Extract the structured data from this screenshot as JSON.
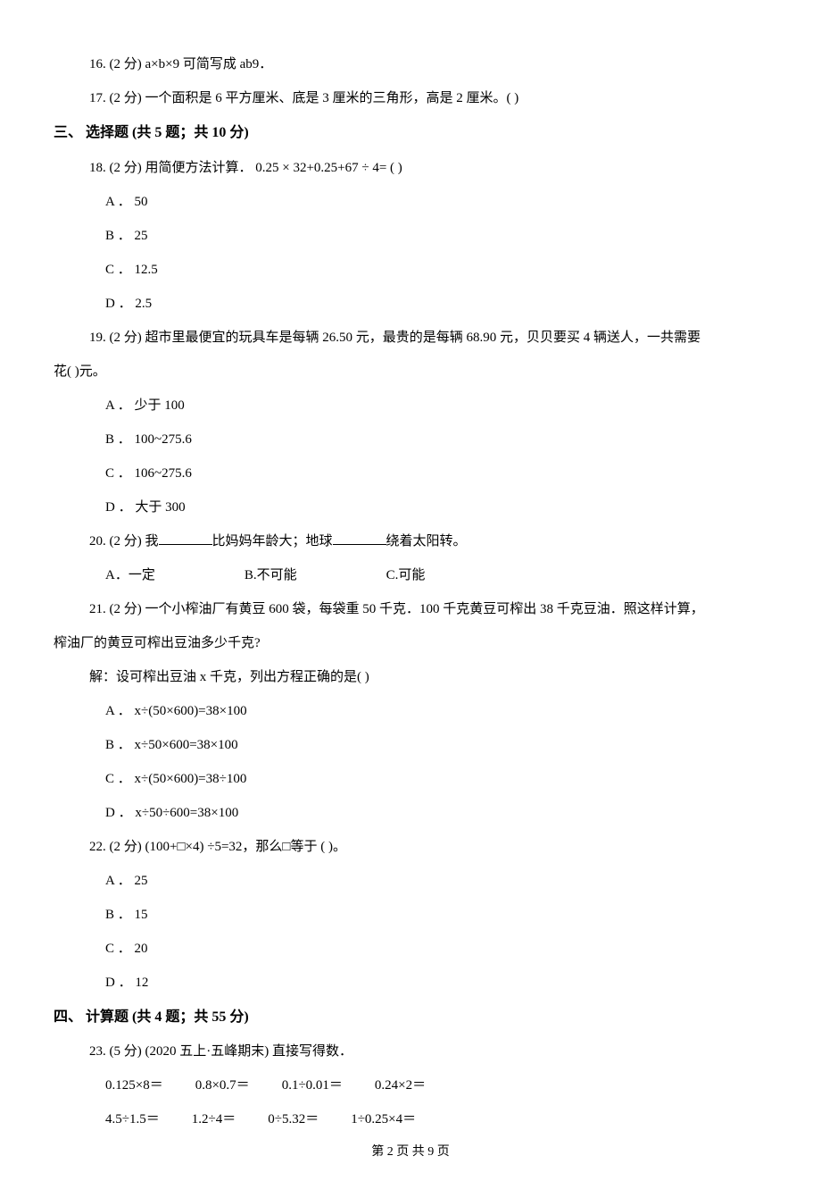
{
  "q16": "16.  (2 分)   a×b×9 可简写成 ab9．",
  "q17": "17.  (2 分)   一个面积是 6 平方厘米、底是 3 厘米的三角形，高是 2 厘米。(        )",
  "section3": "三、  选择题 (共 5 题；共 10 分)",
  "q18": {
    "stem": "18.  (2 分)   用简便方法计算．          0.25  ×  32+0.25+67  ÷  4= (        )",
    "a": "A ．  50",
    "b": "B ．  25",
    "c": "C ．  12.5",
    "d": "D ．  2.5"
  },
  "q19": {
    "stem1": "19.  (2 分)   超市里最便宜的玩具车是每辆 26.50 元，最贵的是每辆 68.90 元，贝贝要买 4 辆送人，一共需要",
    "stem2": "花(        )元。",
    "a": "A ．  少于 100",
    "b": "B ．  100~275.6",
    "c": "C ．  106~275.6",
    "d": "D ．  大于 300"
  },
  "q20": {
    "stem_p1": "20.  (2 分)   我",
    "stem_p2": "比妈妈年龄大；地球",
    "stem_p3": "绕着太阳转。",
    "a": "A．一定",
    "b": "B.不可能",
    "c": "C.可能"
  },
  "q21": {
    "stem1": "21.  (2 分)   一个小榨油厂有黄豆 600 袋，每袋重 50 千克．100 千克黄豆可榨出 38 千克豆油．照这样计算，",
    "stem2": "榨油厂的黄豆可榨出豆油多少千克?",
    "stem3": "解：设可榨出豆油 x 千克，列出方程正确的是(        )",
    "a": "A ．  x÷(50×600)=38×100",
    "b": "B ．  x÷50×600=38×100",
    "c": "C ．  x÷(50×600)=38÷100",
    "d": "D ．  x÷50÷600=38×100"
  },
  "q22": {
    "stem": "22.  (2 分)   (100+□×4) ÷5=32，那么□等于 (        )。",
    "a": "A ．  25",
    "b": "B ．  15",
    "c": "C ．  20",
    "d": "D ．  12"
  },
  "section4": "四、  计算题 (共 4 题；共 55 分)",
  "q23": {
    "stem": "23.  (5 分)   (2020 五上·五峰期末) 直接写得数．",
    "row1": {
      "c1": "0.125×8＝",
      "c2": "0.8×0.7＝",
      "c3": "0.1÷0.01＝",
      "c4": "0.24×2＝"
    },
    "row2": {
      "c1": "4.5÷1.5＝",
      "c2": "1.2÷4＝",
      "c3": "0÷5.32＝",
      "c4": "1÷0.25×4＝"
    }
  },
  "footer": "第 2 页  共 9 页"
}
